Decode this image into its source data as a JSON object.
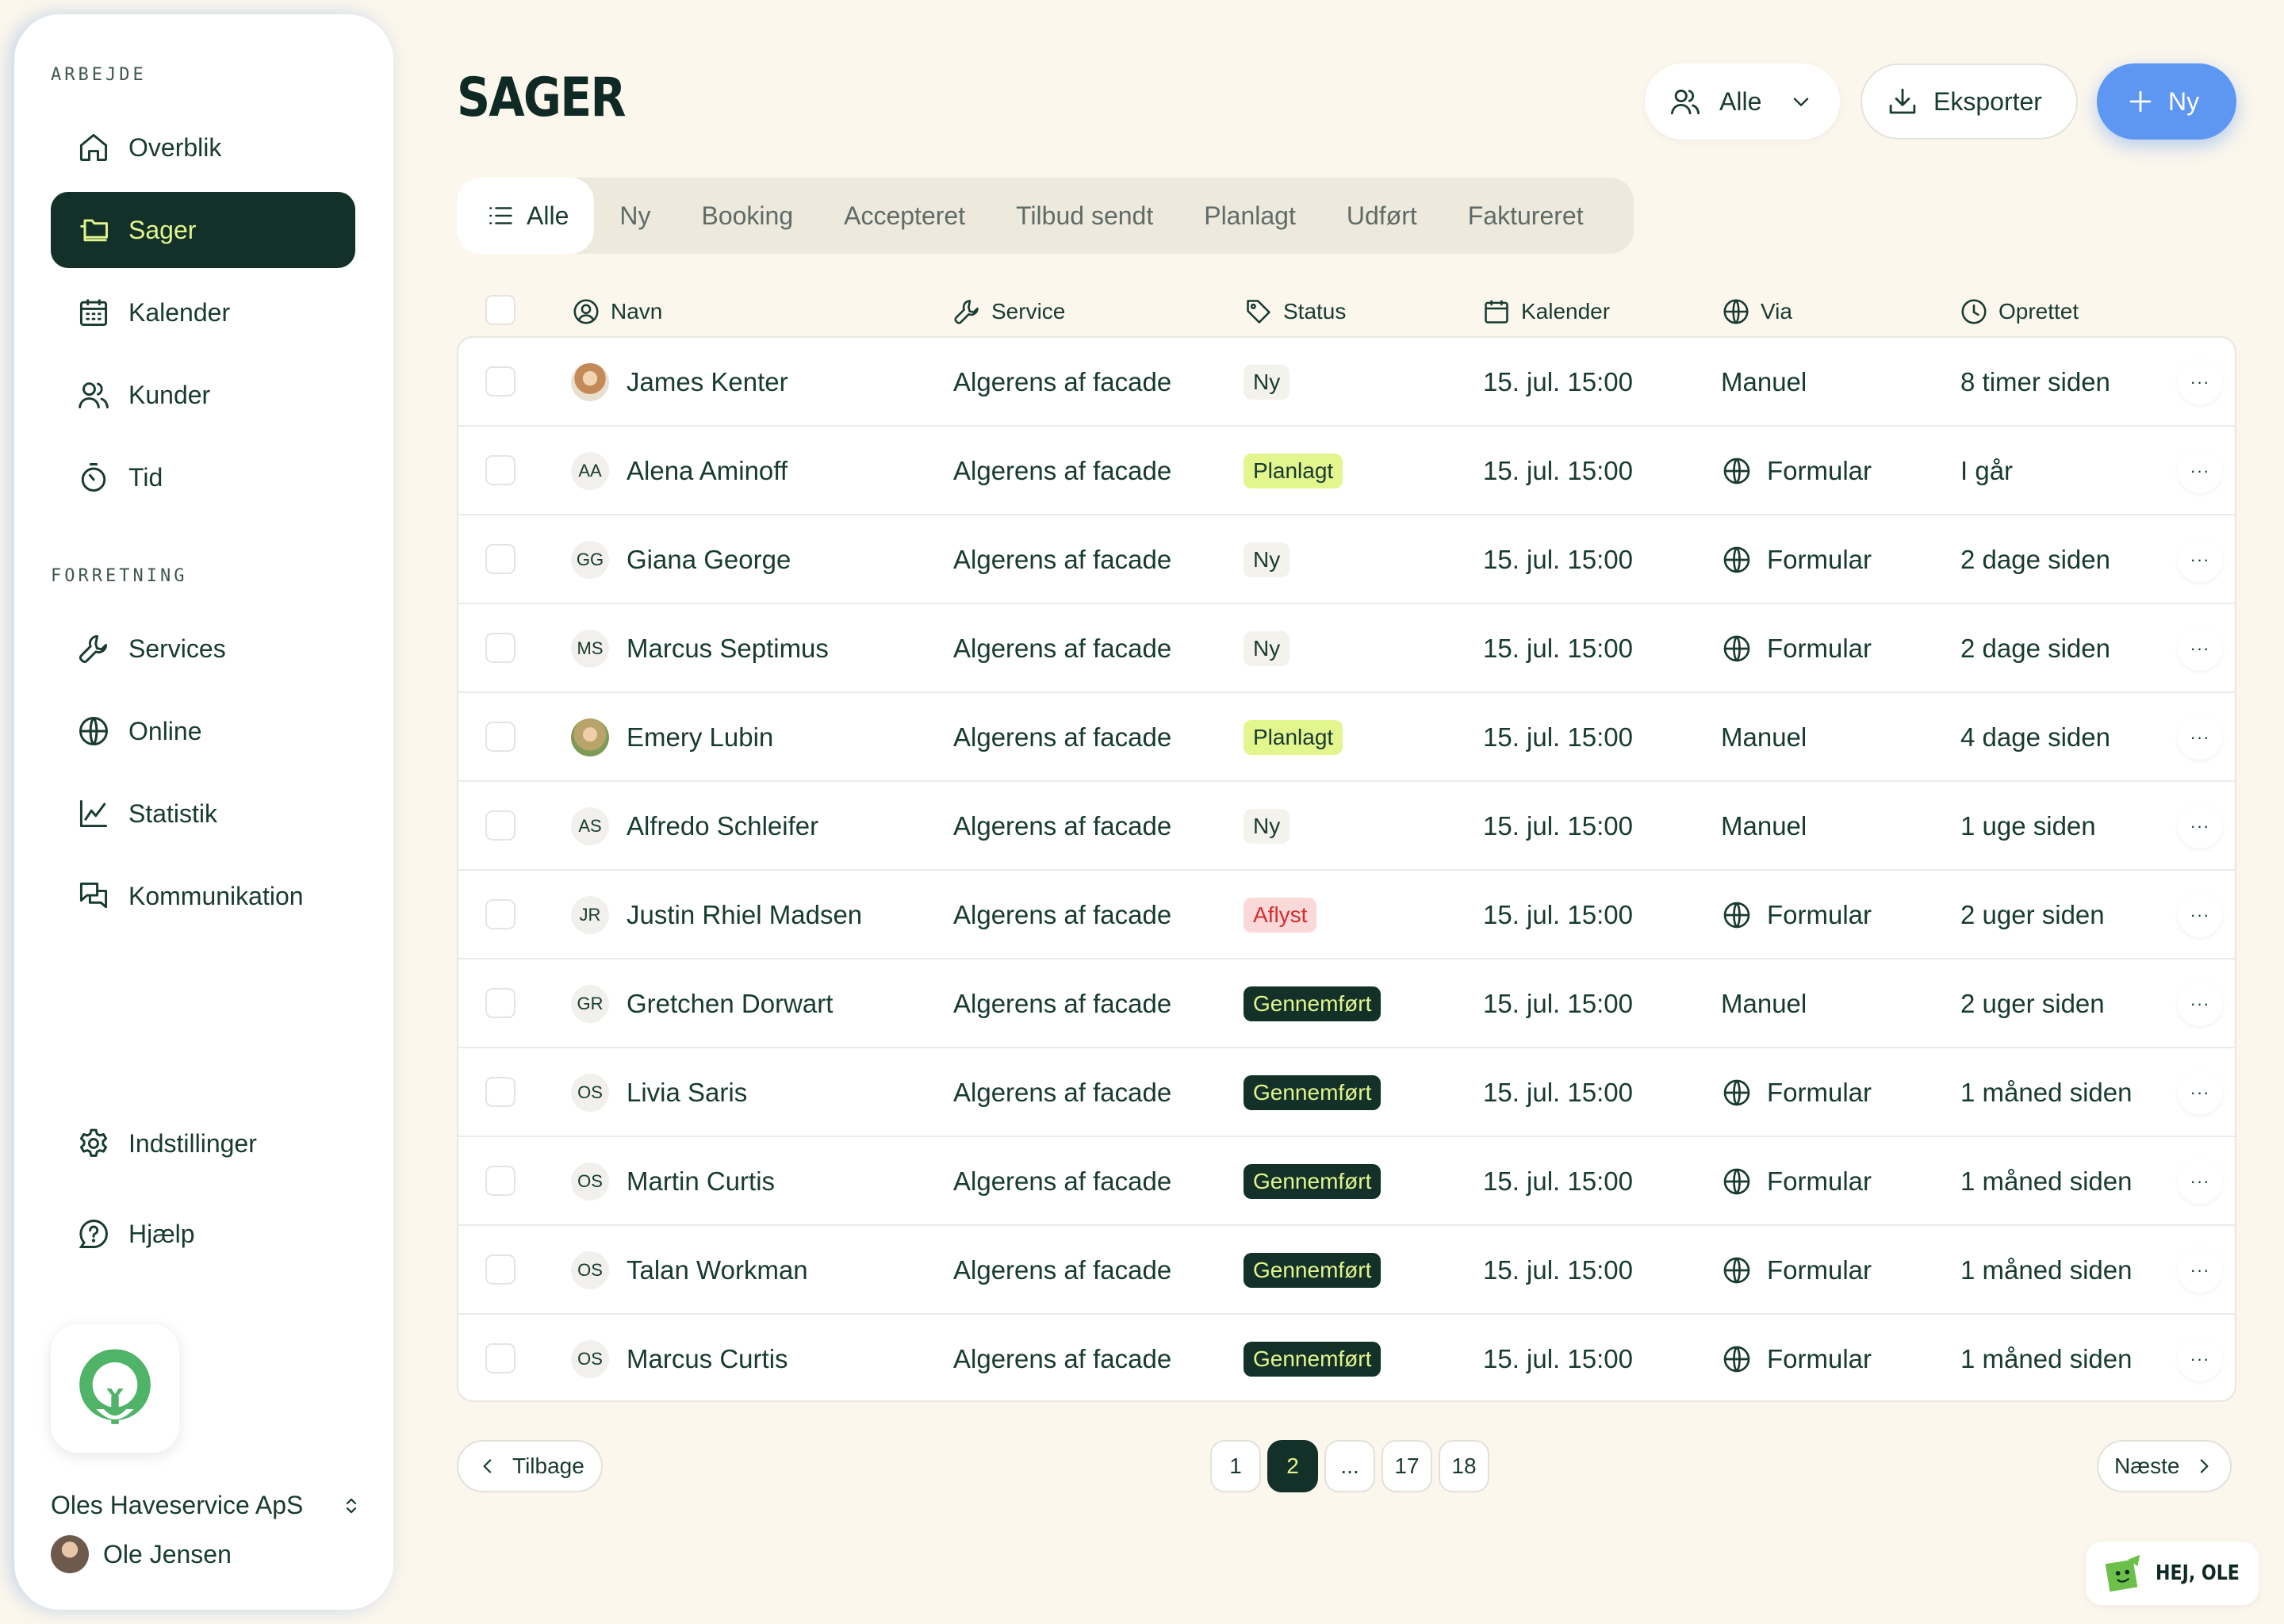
{
  "sidebar": {
    "section_work": "ARBEJDE",
    "section_business": "FORRETNING",
    "items": [
      {
        "label": "Overblik",
        "icon": "home-icon"
      },
      {
        "label": "Sager",
        "icon": "folder-icon",
        "active": true
      },
      {
        "label": "Kalender",
        "icon": "calendar-icon"
      },
      {
        "label": "Kunder",
        "icon": "users-icon"
      },
      {
        "label": "Tid",
        "icon": "stopwatch-icon"
      },
      {
        "label": "Services",
        "icon": "wrench-icon"
      },
      {
        "label": "Online",
        "icon": "globe-icon"
      },
      {
        "label": "Statistik",
        "icon": "chart-line-icon"
      },
      {
        "label": "Kommunikation",
        "icon": "chat-bubbles-icon"
      },
      {
        "label": "Indstillinger",
        "icon": "gear-icon"
      },
      {
        "label": "Hjælp",
        "icon": "help-bubble-icon"
      }
    ],
    "company": "Oles Haveservice ApS",
    "user": "Ole Jensen"
  },
  "header": {
    "title": "SAGER",
    "filter_label": "Alle",
    "export_label": "Eksporter",
    "new_label": "Ny"
  },
  "tabs": [
    "Alle",
    "Ny",
    "Booking",
    "Accepteret",
    "Tilbud sendt",
    "Planlagt",
    "Udført",
    "Faktureret"
  ],
  "columns": [
    "Navn",
    "Service",
    "Status",
    "Kalender",
    "Via",
    "Oprettet"
  ],
  "rows": [
    {
      "avatar": "",
      "name": "James Kenter",
      "service": "Algerens af facade",
      "status": "Ny",
      "calendar": "15. jul. 15:00",
      "via": "Manuel",
      "created": "8 timer siden"
    },
    {
      "avatar": "AA",
      "name": "Alena Aminoff",
      "service": "Algerens af facade",
      "status": "Planlagt",
      "calendar": "15. jul. 15:00",
      "via": "Formular",
      "created": "I går"
    },
    {
      "avatar": "GG",
      "name": "Giana George",
      "service": "Algerens af facade",
      "status": "Ny",
      "calendar": "15. jul. 15:00",
      "via": "Formular",
      "created": "2 dage siden"
    },
    {
      "avatar": "MS",
      "name": "Marcus Septimus",
      "service": "Algerens af facade",
      "status": "Ny",
      "calendar": "15. jul. 15:00",
      "via": "Formular",
      "created": "2 dage siden"
    },
    {
      "avatar": "",
      "name": "Emery Lubin",
      "service": "Algerens af facade",
      "status": "Planlagt",
      "calendar": "15. jul. 15:00",
      "via": "Manuel",
      "created": "4 dage siden"
    },
    {
      "avatar": "AS",
      "name": "Alfredo Schleifer",
      "service": "Algerens af facade",
      "status": "Ny",
      "calendar": "15. jul. 15:00",
      "via": "Manuel",
      "created": "1 uge siden"
    },
    {
      "avatar": "JR",
      "name": "Justin Rhiel Madsen",
      "service": "Algerens af facade",
      "status": "Aflyst",
      "calendar": "15. jul. 15:00",
      "via": "Formular",
      "created": "2 uger siden"
    },
    {
      "avatar": "GR",
      "name": "Gretchen Dorwart",
      "service": "Algerens af facade",
      "status": "Gennemført",
      "calendar": "15. jul. 15:00",
      "via": "Manuel",
      "created": "2 uger siden"
    },
    {
      "avatar": "OS",
      "name": "Livia Saris",
      "service": "Algerens af facade",
      "status": "Gennemført",
      "calendar": "15. jul. 15:00",
      "via": "Formular",
      "created": "1 måned siden"
    },
    {
      "avatar": "OS",
      "name": "Martin Curtis",
      "service": "Algerens af facade",
      "status": "Gennemført",
      "calendar": "15. jul. 15:00",
      "via": "Formular",
      "created": "1 måned siden"
    },
    {
      "avatar": "OS",
      "name": "Talan Workman",
      "service": "Algerens af facade",
      "status": "Gennemført",
      "calendar": "15. jul. 15:00",
      "via": "Formular",
      "created": "1 måned siden"
    },
    {
      "avatar": "OS",
      "name": "Marcus Curtis",
      "service": "Algerens af facade",
      "status": "Gennemført",
      "calendar": "15. jul. 15:00",
      "via": "Formular",
      "created": "1 måned siden"
    }
  ],
  "row_more": "···",
  "pagination": {
    "prev": "Tilbage",
    "next": "Næste",
    "pages": [
      "1",
      "2",
      "...",
      "17",
      "18"
    ],
    "current": "2"
  },
  "greeting": "HEJ, OLE",
  "colors": {
    "background": "#fcf7ec",
    "primary_dark": "#133129",
    "accent_lime": "#e3f58d",
    "accent_blue": "#5e97f2",
    "danger": "#d32f2f"
  }
}
